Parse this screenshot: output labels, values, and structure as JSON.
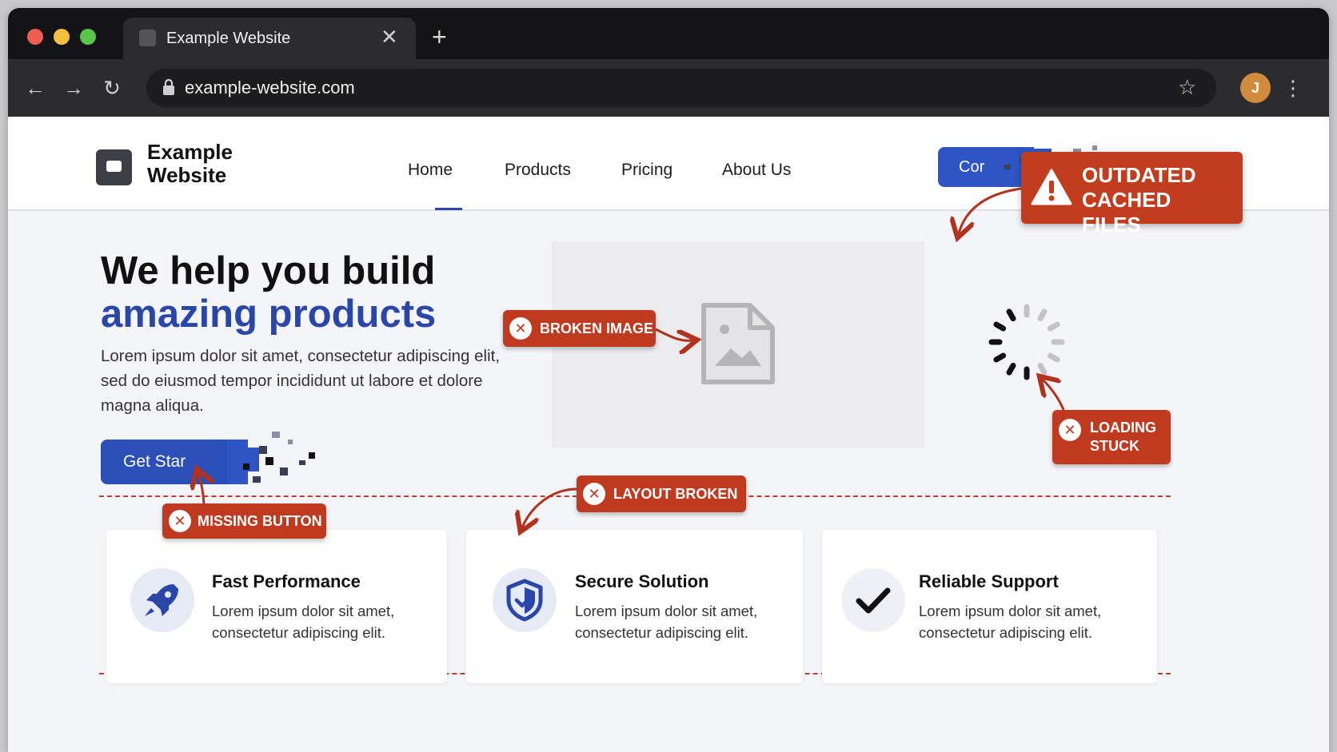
{
  "browser": {
    "tab_title": "Example Website",
    "tab_close": "✕",
    "new_tab": "+",
    "url": "example-website.com",
    "avatar_initial": "J",
    "back": "←",
    "forward": "→",
    "reload": "↻",
    "bookmark": "☆",
    "menu": "⋮"
  },
  "site": {
    "logo_text": "Example Website",
    "nav": [
      "Home",
      "Products",
      "Pricing",
      "About Us"
    ],
    "nav_cta_label": "Cor",
    "hero": {
      "title_line1": "We help you build",
      "title_line2": "amazing products",
      "body": "Lorem ipsum dolor sit amet, consectetur adipiscing elit, sed do eiusmod tempor incididunt ut labore et dolore magna aliqua.",
      "cta_label": "Get Star"
    },
    "features": [
      {
        "title": "Fast Performance",
        "text": "Lorem ipsum dolor sit amet, consectetur adipiscing elit.",
        "icon": "rocket-icon"
      },
      {
        "title": "Secure Solution",
        "text": "Lorem ipsum dolor sit amet, consectetur adipiscing elit.",
        "icon": "shield-icon"
      },
      {
        "title": "Reliable Support",
        "text": "Lorem ipsum dolor sit amet, consectetur adipiscing elit.",
        "icon": "checkmark-icon"
      }
    ]
  },
  "callouts": {
    "outdated": "OUTDATED CACHED FILES",
    "broken_image": "BROKEN IMAGE",
    "loading_stuck": "LOADING STUCK",
    "layout_broken": "LAYOUT BROKEN",
    "missing_button": "MISSING BUTTON",
    "x_mark": "✕"
  },
  "colors": {
    "brand_blue": "#2a46a8",
    "button_blue": "#2f55c4",
    "callout_red": "#bf3a1f",
    "browser_dark": "#141416"
  }
}
